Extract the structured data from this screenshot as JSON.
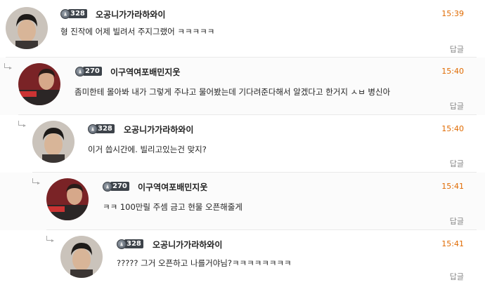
{
  "reply_label": "답글",
  "comments": [
    {
      "level": "328",
      "nickname": "오공니가가라하와이",
      "time": "15:39",
      "text": "형 진작에 어제 빌려서 주지그랬어 ㅋㅋㅋㅋㅋ",
      "avatar_colors": {
        "bg": "#c9c2ba",
        "face": "#d9b79a",
        "hair": "#1d1a18"
      }
    },
    {
      "level": "270",
      "nickname": "이구역여포배민지웃",
      "time": "15:40",
      "text": "좀미한테 몰아봐 내가 그렇게 주냐고 물어봤는데 기다려준다해서 알겠다고 한거지 ㅅㅂ 병신아",
      "avatar_colors": {
        "bg": "#7a2326",
        "face": "#d6a88a",
        "hair": "#2a1c18"
      }
    },
    {
      "level": "328",
      "nickname": "오공니가가라하와이",
      "time": "15:40",
      "text": "이거 씁시간에. 빌리고있는건 맞지?",
      "avatar_colors": {
        "bg": "#c9c2ba",
        "face": "#d9b79a",
        "hair": "#1d1a18"
      }
    },
    {
      "level": "270",
      "nickname": "이구역여포배민지웃",
      "time": "15:41",
      "text": "ㅋㅋ 100만릴 주셈 금고 현물 오픈해줄게",
      "avatar_colors": {
        "bg": "#7a2326",
        "face": "#d6a88a",
        "hair": "#2a1c18"
      }
    },
    {
      "level": "328",
      "nickname": "오공니가가라하와이",
      "time": "15:41",
      "text": "????? 그거 오픈하고 나를거야님?ㅋㅋㅋㅋㅋㅋㅋㅋ",
      "avatar_colors": {
        "bg": "#c9c2ba",
        "face": "#d9b79a",
        "hair": "#1d1a18"
      }
    }
  ]
}
